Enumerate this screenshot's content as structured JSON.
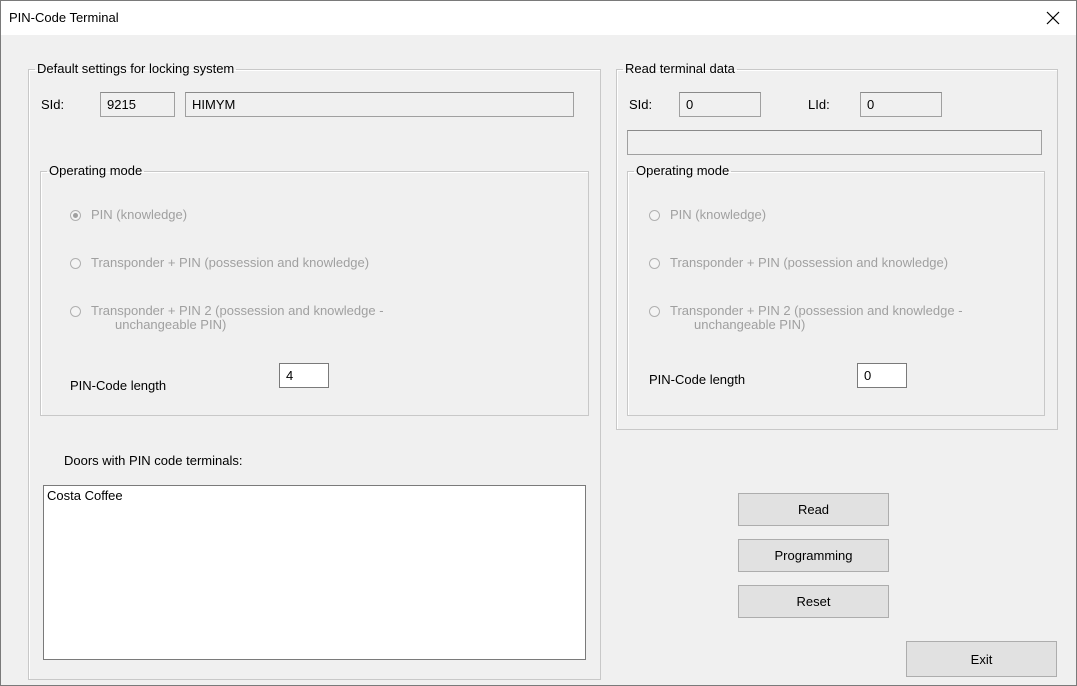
{
  "window": {
    "title": "PIN-Code Terminal"
  },
  "default_settings": {
    "legend": "Default settings for locking system",
    "sid_label": "SId:",
    "sid_value": "9215",
    "system_name": "HIMYM",
    "operating_mode": {
      "legend": "Operating mode",
      "options": [
        {
          "label": "PIN (knowledge)",
          "checked": true
        },
        {
          "label": "Transponder + PIN (possession and knowledge)",
          "checked": false
        },
        {
          "label_line1": "Transponder + PIN 2 (possession and knowledge -",
          "label_line2": "unchangeable PIN)",
          "checked": false
        }
      ],
      "pin_length_label": "PIN-Code length",
      "pin_length_value": "4"
    }
  },
  "doors": {
    "label": "Doors with PIN code terminals:",
    "items": [
      "Costa Coffee"
    ]
  },
  "read_terminal": {
    "legend": "Read terminal data",
    "sid_label": "SId:",
    "sid_value": "0",
    "lid_label": "LId:",
    "lid_value": "0",
    "info_value": "",
    "operating_mode": {
      "legend": "Operating mode",
      "options": [
        {
          "label": "PIN (knowledge)",
          "checked": false
        },
        {
          "label": "Transponder + PIN (possession and knowledge)",
          "checked": false
        },
        {
          "label_line1": "Transponder + PIN 2 (possession and knowledge -",
          "label_line2": "unchangeable PIN)",
          "checked": false
        }
      ],
      "pin_length_label": "PIN-Code length",
      "pin_length_value": "0"
    }
  },
  "buttons": {
    "read": "Read",
    "programming": "Programming",
    "reset": "Reset",
    "exit": "Exit"
  }
}
